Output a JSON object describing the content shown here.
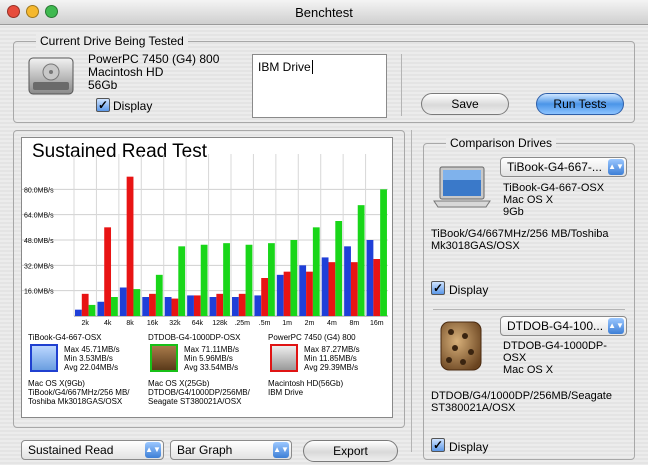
{
  "window": {
    "title": "Benchtest"
  },
  "current_drive": {
    "legend": "Current Drive Being Tested",
    "info": [
      "PowerPC 7450 (G4) 800",
      "Macintosh HD",
      "56Gb"
    ],
    "display_label": "Display",
    "display_checked": true,
    "name_value": "IBM Drive"
  },
  "buttons": {
    "save": "Save",
    "run_tests": "Run Tests",
    "export": "Export"
  },
  "chart_panel": {
    "drives": [
      {
        "name": "TiBook-G4-667-OSX",
        "max": "Max 45.71MB/s",
        "min": "Min 3.53MB/s",
        "avg": "Avg 22.04MB/s",
        "info": [
          "Mac OS X(9Gb)",
          "TiBook/G4/667MHz/256 MB/",
          "Toshiba Mk3018GAS/OSX"
        ]
      },
      {
        "name": "DTDOB-G4-1000DP-OSX",
        "max": "Max 71.11MB/s",
        "min": "Min 5.96MB/s",
        "avg": "Avg 33.54MB/s",
        "info": [
          "Mac OS X(25Gb)",
          "DTDOB/G4/1000DP/256MB/",
          "Seagate ST380021A/OSX"
        ]
      },
      {
        "name": "PowerPC 7450 (G4) 800",
        "max": "Max 87.27MB/s",
        "min": "Min 11.85MB/s",
        "avg": "Avg 29.39MB/s",
        "info": [
          "Macintosh HD(56Gb)",
          "IBM Drive",
          ""
        ]
      }
    ]
  },
  "chart_data": {
    "type": "bar",
    "title": "Sustained Read Test",
    "categories": [
      "2k",
      "4k",
      "8k",
      "16k",
      "32k",
      "64k",
      "128k",
      ".25m",
      ".5m",
      "1m",
      "2m",
      "4m",
      "8m",
      "16m"
    ],
    "y_ticks": [
      "80.0MB/s",
      "64.0MB/s",
      "48.0MB/s",
      "32.0MB/s",
      "16.0MB/s"
    ],
    "ylim": [
      0,
      96
    ],
    "series": [
      {
        "color": "#1f3fd8",
        "values": [
          4,
          9,
          18,
          12,
          12,
          13,
          12,
          12,
          13,
          26,
          32,
          37,
          44,
          48
        ]
      },
      {
        "color": "#e81414",
        "values": [
          14,
          56,
          88,
          14,
          11,
          13,
          14,
          14,
          24,
          28,
          28,
          34,
          34,
          36
        ]
      },
      {
        "color": "#19d619",
        "values": [
          7,
          12,
          17,
          26,
          44,
          45,
          46,
          45,
          46,
          48,
          56,
          60,
          70,
          80
        ]
      }
    ]
  },
  "bottom_controls": {
    "test_popup": "Sustained Read",
    "graph_popup": "Bar Graph"
  },
  "comparison": {
    "legend": "Comparison Drives",
    "drives": [
      {
        "popup": "TiBook-G4-667-...",
        "info": [
          "TiBook-G4-667-OSX",
          "Mac OS X",
          "9Gb"
        ],
        "desc": [
          "TiBook/G4/667MHz/256 MB/Toshiba",
          "Mk3018GAS/OSX"
        ],
        "display_label": "Display"
      },
      {
        "popup": "DTDOB-G4-100...",
        "info": [
          "DTDOB-G4-1000DP-",
          "OSX",
          "Mac OS X"
        ],
        "desc": [
          "DTDOB/G4/1000DP/256MB/Seagate",
          "ST380021A/OSX"
        ],
        "display_label": "Display"
      }
    ]
  },
  "colors": {
    "close": "#e74c3c",
    "minimize": "#f5b82e",
    "zoom": "#3fb950",
    "accent": "#4b95e8"
  }
}
